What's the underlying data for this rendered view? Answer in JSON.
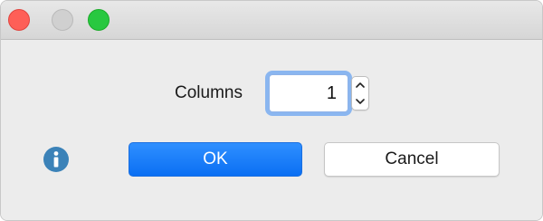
{
  "window": {
    "title": ""
  },
  "form": {
    "columns_label": "Columns",
    "columns_value": "1"
  },
  "buttons": {
    "ok_label": "OK",
    "cancel_label": "Cancel"
  },
  "icons": {
    "info": "info-icon",
    "stepper_up": "chevron-up-icon",
    "stepper_down": "chevron-down-icon"
  },
  "colors": {
    "accent": "#0a6ff3",
    "info": "#3b82b8",
    "close": "#fe5f57",
    "zoom": "#28c840",
    "minimize_disabled": "#d0d0d0"
  }
}
